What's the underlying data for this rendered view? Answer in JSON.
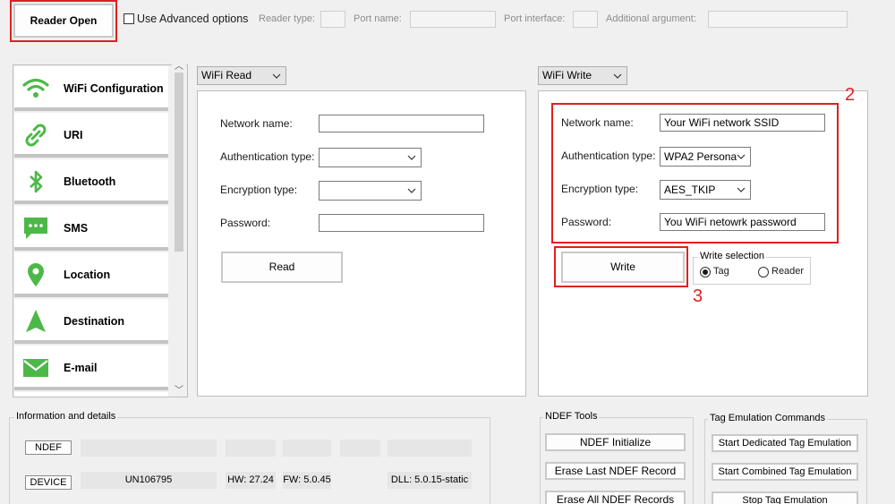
{
  "toolbar": {
    "reader_open": "Reader Open",
    "advanced_options": "Use Advanced options",
    "reader_type": "Reader type:",
    "port_name": "Port name:",
    "port_interface": "Port interface:",
    "additional_argument": "Additional argument:"
  },
  "sidebar": {
    "items": [
      {
        "label": "WiFi Configuration",
        "icon": "wifi-icon"
      },
      {
        "label": "URI",
        "icon": "link-icon"
      },
      {
        "label": "Bluetooth",
        "icon": "bluetooth-icon"
      },
      {
        "label": "SMS",
        "icon": "sms-icon"
      },
      {
        "label": "Location",
        "icon": "location-pin-icon"
      },
      {
        "label": "Destination",
        "icon": "navigation-arrow-icon"
      },
      {
        "label": "E-mail",
        "icon": "email-icon"
      }
    ],
    "accent_color": "#4cb848"
  },
  "read_panel": {
    "mode": "WiFi Read",
    "network_name_label": "Network name:",
    "auth_type_label": "Authentication type:",
    "encryption_type_label": "Encryption type:",
    "password_label": "Password:",
    "read_button": "Read"
  },
  "write_panel": {
    "mode": "WiFi Write",
    "network_name_label": "Network name:",
    "network_name_value": "Your WiFi network SSID",
    "auth_type_label": "Authentication type:",
    "auth_type_value": "WPA2 Persona",
    "encryption_type_label": "Encryption type:",
    "encryption_type_value": "AES_TKIP",
    "password_label": "Password:",
    "password_value": "You WiFi netowrk password",
    "write_button": "Write",
    "write_selection_title": "Write selection",
    "option_tag": "Tag",
    "option_reader": "Reader",
    "selected_option": "Tag"
  },
  "annotations": {
    "marker_2": "2",
    "marker_3": "3",
    "highlight_color": "#e02020"
  },
  "info": {
    "title": "Information and details",
    "ndef_button": "NDEF",
    "device_button": "DEVICE",
    "device_id": "UN106795",
    "hw": "HW: 27.24",
    "fw": "FW: 5.0.45",
    "dll": "DLL: 5.0.15-static"
  },
  "ndef_tools": {
    "title": "NDEF Tools",
    "initialize": "NDEF Initialize",
    "erase_last": "Erase Last NDEF Record",
    "erase_all": "Erase All NDEF Records"
  },
  "emulation": {
    "title": "Tag Emulation Commands",
    "start_dedicated": "Start Dedicated Tag Emulation",
    "start_combined": "Start Combined Tag Emulation",
    "stop": "Stop Tag Emulation"
  }
}
